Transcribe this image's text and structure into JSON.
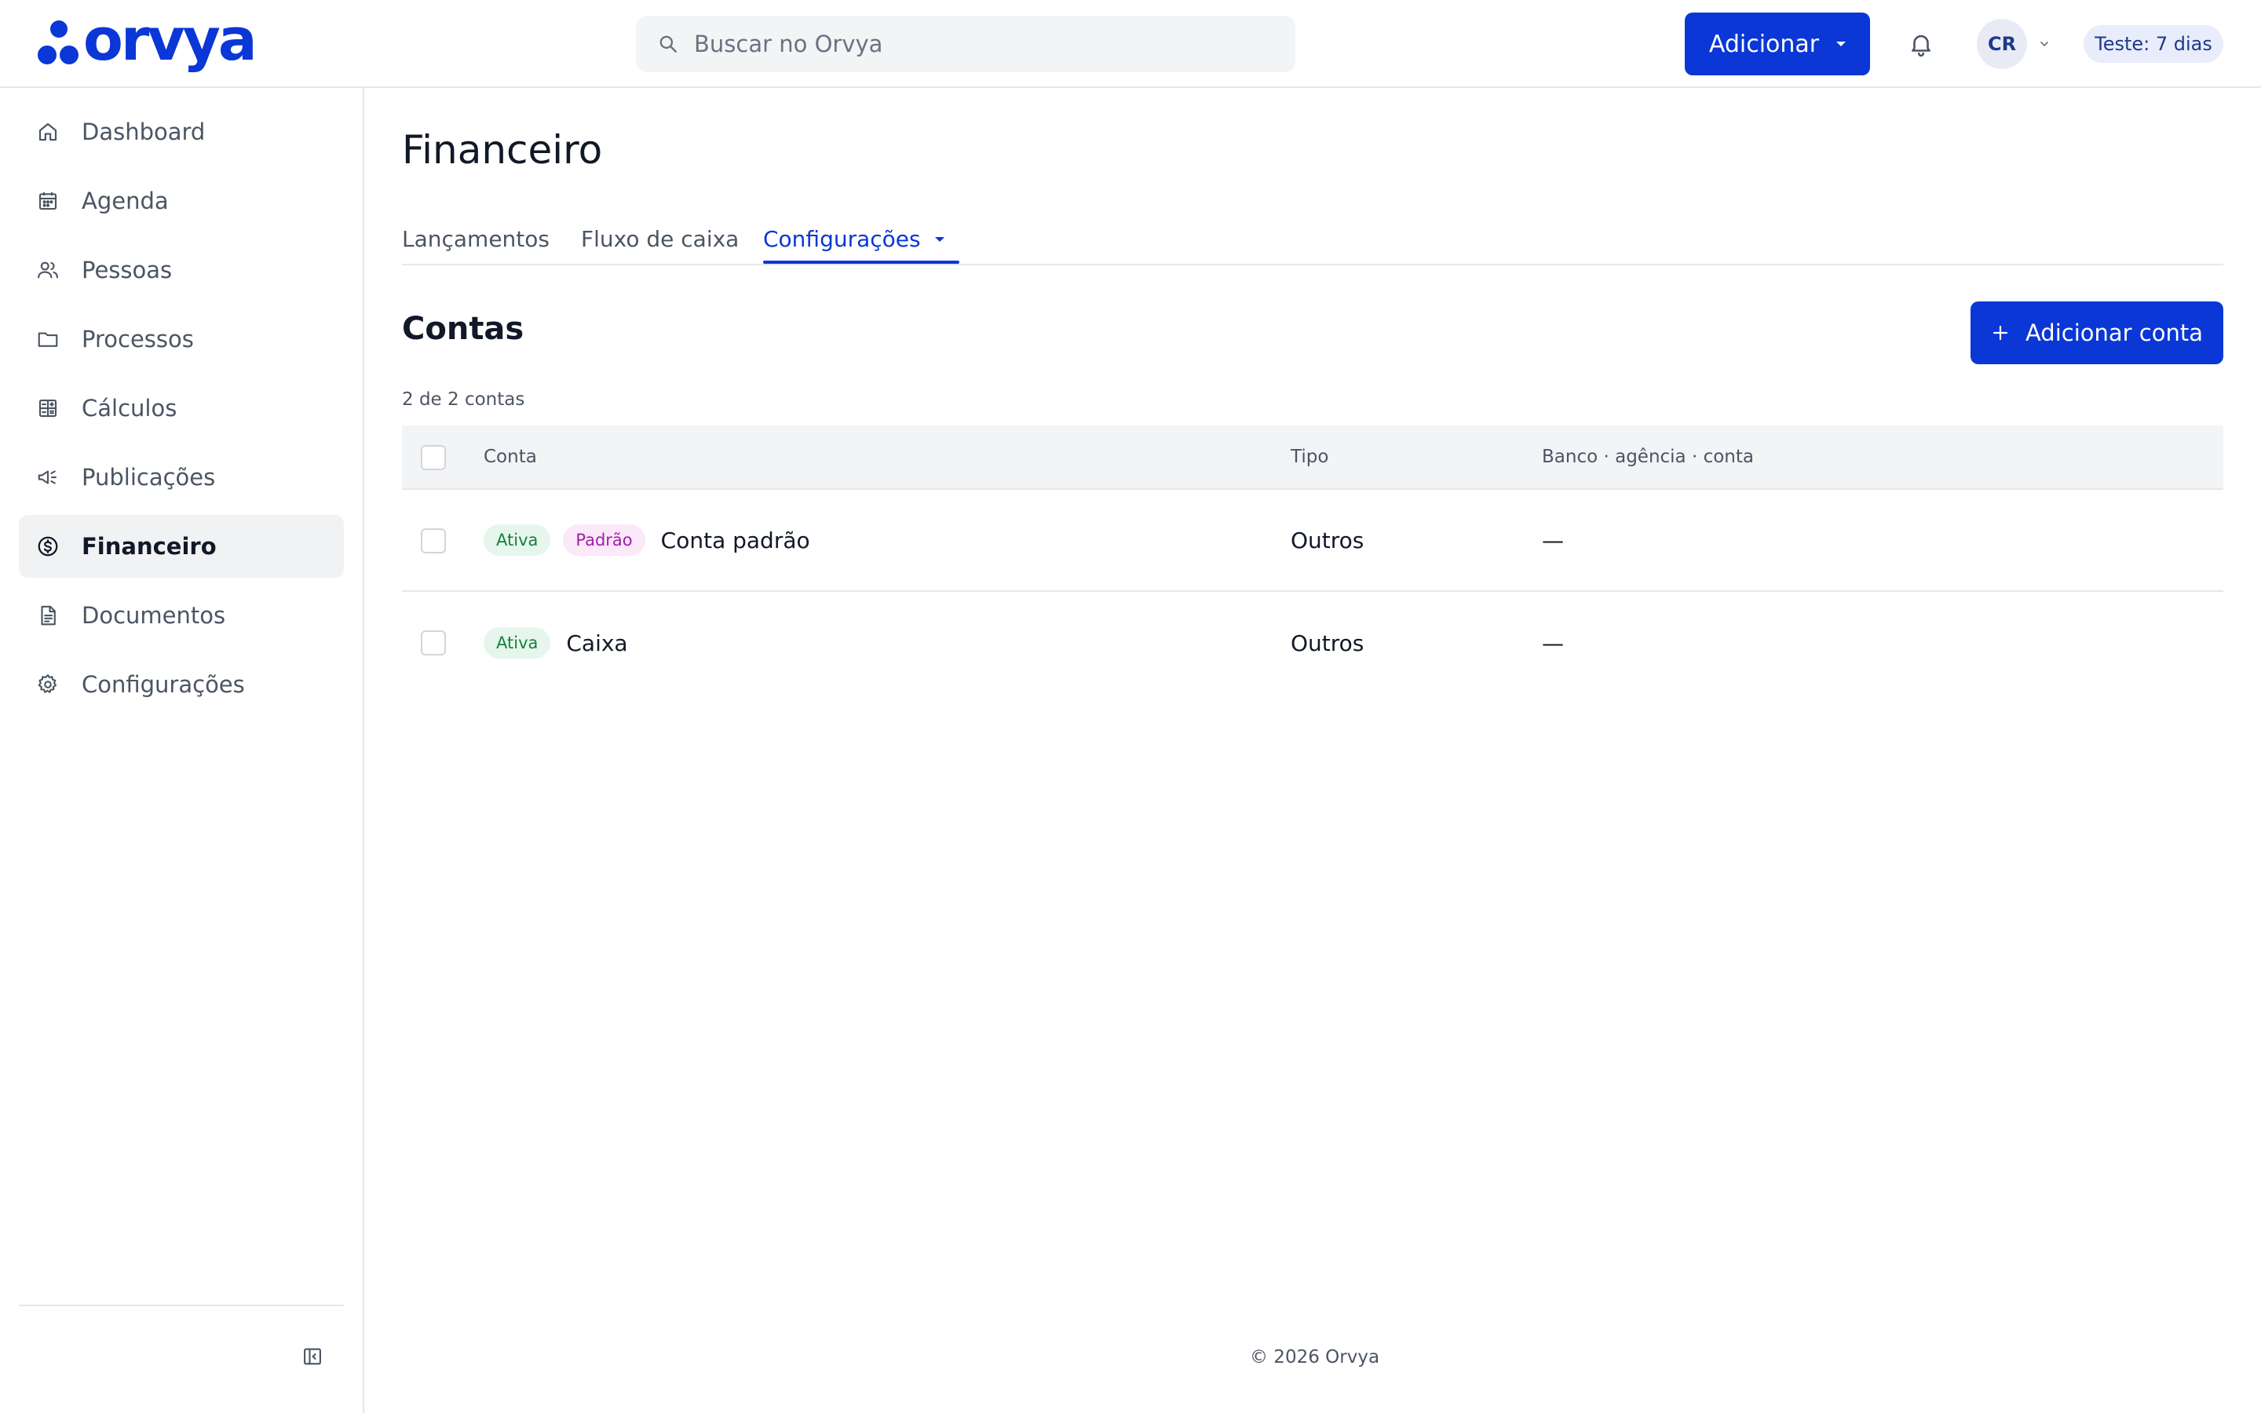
{
  "app": {
    "logo_text": "orvya"
  },
  "search": {
    "placeholder": "Buscar no Orvya"
  },
  "header": {
    "add_label": "Adicionar",
    "avatar_initials": "CR",
    "trial_label": "Teste: 7 dias"
  },
  "sidebar": {
    "items": [
      {
        "label": "Dashboard",
        "icon": "home-icon",
        "active": false
      },
      {
        "label": "Agenda",
        "icon": "calendar-icon",
        "active": false
      },
      {
        "label": "Pessoas",
        "icon": "users-icon",
        "active": false
      },
      {
        "label": "Processos",
        "icon": "folder-icon",
        "active": false
      },
      {
        "label": "Cálculos",
        "icon": "calculator-icon",
        "active": false
      },
      {
        "label": "Publicações",
        "icon": "megaphone-icon",
        "active": false
      },
      {
        "label": "Financeiro",
        "icon": "dollar-circle-icon",
        "active": true
      },
      {
        "label": "Documentos",
        "icon": "document-icon",
        "active": false
      },
      {
        "label": "Configurações",
        "icon": "gear-icon",
        "active": false
      }
    ]
  },
  "page": {
    "title": "Financeiro"
  },
  "tabs": [
    {
      "label": "Lançamentos",
      "active": false
    },
    {
      "label": "Fluxo de caixa",
      "active": false
    },
    {
      "label": "Configurações",
      "active": true
    }
  ],
  "section": {
    "title": "Contas",
    "add_account_label": "Adicionar conta",
    "count_text": "2 de 2 contas"
  },
  "table": {
    "columns": [
      "Conta",
      "Tipo",
      "Banco · agência · conta"
    ],
    "rows": [
      {
        "badges": [
          "Ativa",
          "Padrão"
        ],
        "name": "Conta padrão",
        "tipo": "Outros",
        "banco": "—"
      },
      {
        "badges": [
          "Ativa"
        ],
        "name": "Caixa",
        "tipo": "Outros",
        "banco": "—"
      }
    ]
  },
  "footer": {
    "text": "© 2026 Orvya"
  },
  "colors": {
    "primary": "#0a37d6",
    "active_badge": "#15803d",
    "default_badge": "#a21caf"
  }
}
